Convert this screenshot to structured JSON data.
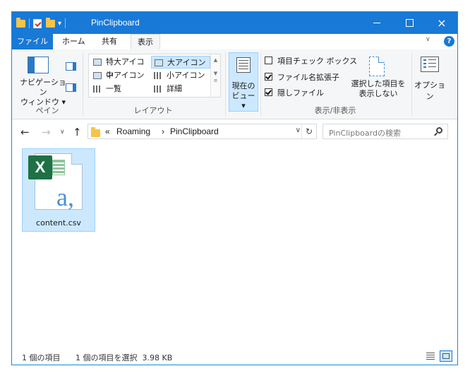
{
  "window": {
    "title": "PinClipboard",
    "controls": {
      "minimize": "minimize-icon",
      "maximize": "maximize-icon",
      "close": "×"
    }
  },
  "ribbon_tabs": [
    "ファイル",
    "ホーム",
    "共有",
    "表示"
  ],
  "active_tab": "表示",
  "groups": {
    "pane": {
      "label": "ペイン",
      "navigation_pane": "ナビゲーション\nウィンドウ ▾"
    },
    "layout": {
      "label": "レイアウト",
      "items": [
        "特大アイコン",
        "大アイコン",
        "中アイコン",
        "小アイコン",
        "一覧",
        "詳細"
      ],
      "selected": "大アイコン"
    },
    "current_view": {
      "label": "現在の\nビュー ▾"
    },
    "show_hide": {
      "label": "表示/非表示",
      "item_checkboxes": {
        "label": "項目チェック ボックス",
        "checked": false
      },
      "file_extensions": {
        "label": "ファイル名拡張子",
        "checked": true
      },
      "hidden_items": {
        "label": "隠しファイル",
        "checked": true
      },
      "hide_selected": "選択した項目を\n表示しない"
    },
    "options": {
      "label": "オプション"
    }
  },
  "address": {
    "overflow": "«",
    "segments": [
      "Roaming",
      "PinClipboard"
    ],
    "separator": "›"
  },
  "search": {
    "placeholder": "PinClipboardの検索"
  },
  "files": [
    {
      "name": "content.csv",
      "icon": "excel-csv-file-icon",
      "selected": true
    }
  ],
  "status": {
    "item_count": "1 個の項目",
    "selection": "1 個の項目を選択  3.98 KB"
  },
  "colors": {
    "accent": "#1979d6",
    "selection": "#cce8ff",
    "excel_green": "#1e7145"
  }
}
